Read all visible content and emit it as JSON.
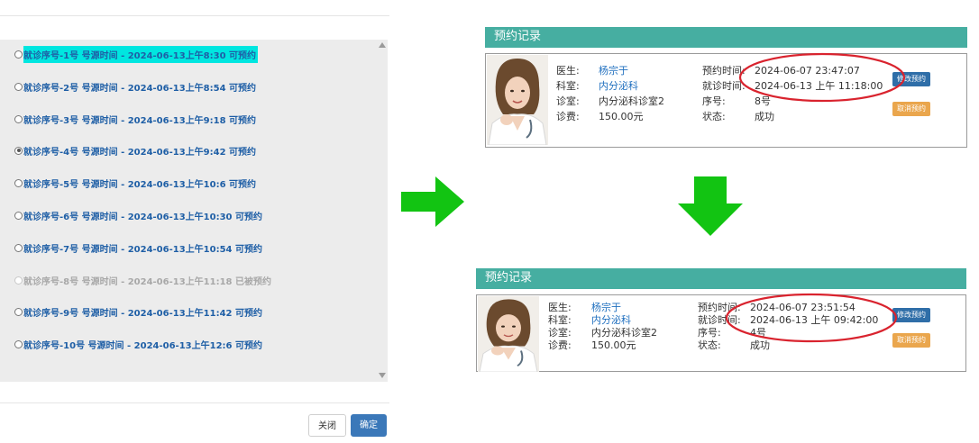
{
  "modal": {
    "slots": [
      {
        "label": "就诊序号-1号 号源时间 - 2024-06-13上午8:30 可预约",
        "selected": false,
        "disabled": false,
        "highlight": true
      },
      {
        "label": "就诊序号-2号 号源时间 - 2024-06-13上午8:54 可预约",
        "selected": false,
        "disabled": false,
        "highlight": false
      },
      {
        "label": "就诊序号-3号 号源时间 - 2024-06-13上午9:18 可预约",
        "selected": false,
        "disabled": false,
        "highlight": false
      },
      {
        "label": "就诊序号-4号 号源时间 - 2024-06-13上午9:42 可预约",
        "selected": true,
        "disabled": false,
        "highlight": false
      },
      {
        "label": "就诊序号-5号 号源时间 - 2024-06-13上午10:6 可预约",
        "selected": false,
        "disabled": false,
        "highlight": false
      },
      {
        "label": "就诊序号-6号 号源时间 - 2024-06-13上午10:30 可预约",
        "selected": false,
        "disabled": false,
        "highlight": false
      },
      {
        "label": "就诊序号-7号 号源时间 - 2024-06-13上午10:54 可预约",
        "selected": false,
        "disabled": false,
        "highlight": false
      },
      {
        "label": "就诊序号-8号 号源时间 - 2024-06-13上午11:18 已被预约",
        "selected": false,
        "disabled": true,
        "highlight": false
      },
      {
        "label": "就诊序号-9号 号源时间 - 2024-06-13上午11:42 可预约",
        "selected": false,
        "disabled": false,
        "highlight": false
      },
      {
        "label": "就诊序号-10号 号源时间 - 2024-06-13上午12:6 可预约",
        "selected": false,
        "disabled": false,
        "highlight": false
      }
    ],
    "close_label": "关闭",
    "confirm_label": "确定"
  },
  "colors": {
    "arrow": "#12c412",
    "ellipse": "#d9232e",
    "header": "#46aea1",
    "modify_button": "#2f6ea8",
    "cancel_button": "#eaa64d",
    "highlight": "#00e6e0"
  },
  "record_before": {
    "header": "预约记录",
    "doctor_label": "医生:",
    "doctor": "杨宗于",
    "dept_label": "科室:",
    "dept": "内分泌科",
    "room_label": "诊室:",
    "room": "内分泌科诊室2",
    "fee_label": "诊费:",
    "fee": "150.00元",
    "book_time_label": "预约时间:",
    "book_time": "2024-06-07 23:47:07",
    "visit_time_label": "就诊时间:",
    "visit_time": "2024-06-13 上午 11:18:00",
    "seq_label": "序号:",
    "seq": "8号",
    "status_label": "状态:",
    "status": "成功",
    "modify_label": "修改预约",
    "cancel_label": "取消预约"
  },
  "record_after": {
    "header": "预约记录",
    "doctor_label": "医生:",
    "doctor": "杨宗于",
    "dept_label": "科室:",
    "dept": "内分泌科",
    "room_label": "诊室:",
    "room": "内分泌科诊室2",
    "fee_label": "诊费:",
    "fee": "150.00元",
    "book_time_label": "预约时间:",
    "book_time": "2024-06-07 23:51:54",
    "visit_time_label": "就诊时间:",
    "visit_time": "2024-06-13 上午 09:42:00",
    "seq_label": "序号:",
    "seq": "4号",
    "status_label": "状态:",
    "status": "成功",
    "modify_label": "修改预约",
    "cancel_label": "取消预约"
  }
}
